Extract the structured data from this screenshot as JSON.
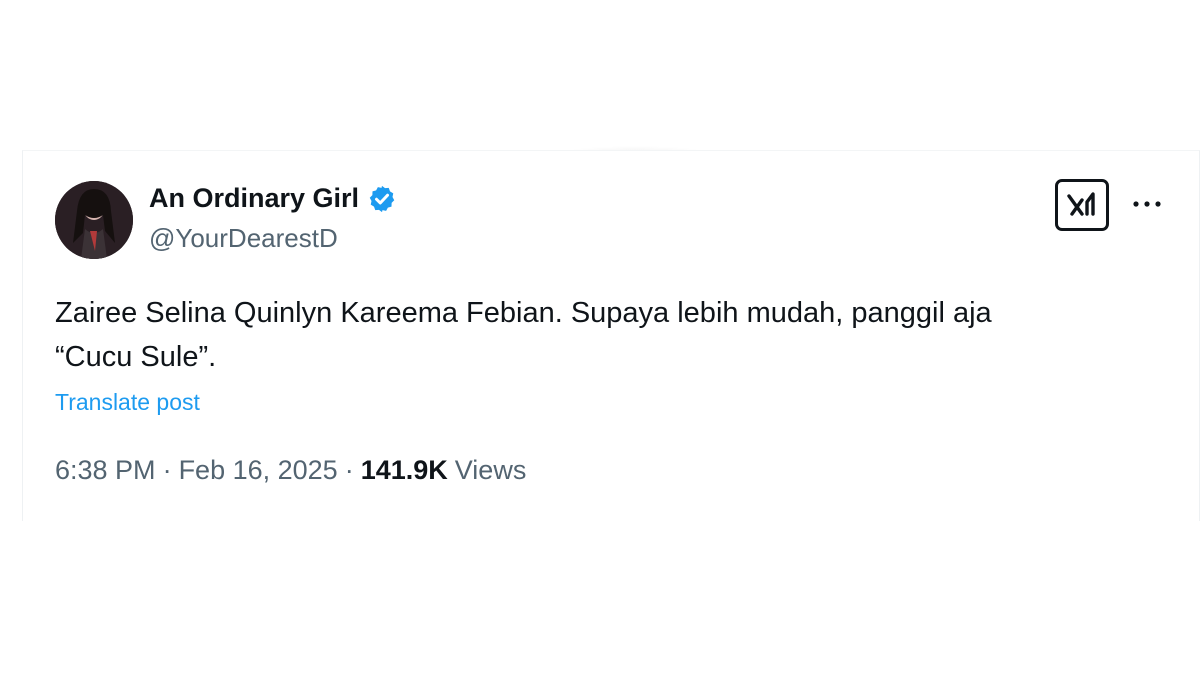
{
  "author": {
    "display_name": "An Ordinary Girl",
    "handle": "@YourDearestD",
    "verified": true
  },
  "post": {
    "text": "Zairee Selina Quinlyn Kareema Febian. Supaya lebih mudah, panggil aja\n“Cucu Sule”.",
    "translate_label": "Translate post"
  },
  "meta": {
    "time": "6:38 PM",
    "separator": "·",
    "date": "Feb 16, 2025",
    "views_count": "141.9K",
    "views_label": "Views"
  },
  "icons": {
    "verified": "verified-badge-icon",
    "grok": "grok-icon",
    "more": "more-icon"
  },
  "colors": {
    "accent": "#1d9bf0",
    "text": "#0f1419",
    "secondary": "#536471"
  }
}
